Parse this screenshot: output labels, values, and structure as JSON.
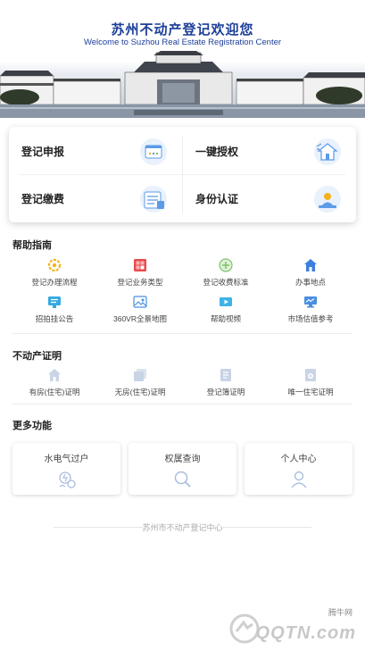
{
  "banner": {
    "title": "苏州不动产登记欢迎您",
    "subtitle": "Welcome to Suzhou Real Estate Registration Center"
  },
  "quick": [
    {
      "label": "登记申报",
      "icon": "form-icon"
    },
    {
      "label": "一键授权",
      "icon": "home-authorize-icon"
    },
    {
      "label": "登记缴费",
      "icon": "payment-icon"
    },
    {
      "label": "身份认证",
      "icon": "identity-card-icon"
    }
  ],
  "help": {
    "title": "帮助指南",
    "items": [
      {
        "label": "登记办理流程",
        "icon": "process-icon",
        "color": "#f3b31a"
      },
      {
        "label": "登记业务类型",
        "icon": "business-type-icon",
        "color": "#e84b4b"
      },
      {
        "label": "登记收费标准",
        "icon": "fee-standard-icon",
        "color": "#7fc36b"
      },
      {
        "label": "办事地点",
        "icon": "location-home-icon",
        "color": "#3d7fe0"
      },
      {
        "label": "招拍挂公告",
        "icon": "announcement-icon",
        "color": "#35a9e0"
      },
      {
        "label": "360VR全景地图",
        "icon": "vr-map-icon",
        "color": "#4a8fe0"
      },
      {
        "label": "帮助视频",
        "icon": "video-icon",
        "color": "#3db4e8"
      },
      {
        "label": "市场估值参考",
        "icon": "market-value-icon",
        "color": "#4a8fe0"
      }
    ]
  },
  "certificate": {
    "title": "不动产证明",
    "items": [
      {
        "label": "有房(住宅)证明",
        "icon": "house-icon"
      },
      {
        "label": "无房(住宅)证明",
        "icon": "no-house-icon"
      },
      {
        "label": "登记簿证明",
        "icon": "register-book-icon"
      },
      {
        "label": "唯一住宅证明",
        "icon": "unique-house-icon"
      }
    ]
  },
  "more": {
    "title": "更多功能",
    "items": [
      {
        "label": "水电气过户",
        "icon": "utility-transfer-icon"
      },
      {
        "label": "权属查询",
        "icon": "search-icon"
      },
      {
        "label": "个人中心",
        "icon": "user-icon"
      }
    ]
  },
  "footer": "苏州市不动产登记中心",
  "watermark": {
    "small": "腾牛网",
    "big": "QQTN.com"
  },
  "colors": {
    "brand": "#1d3f9a",
    "icon_blue": "#3d7fe0",
    "icon_gray": "#c9d4e6"
  }
}
